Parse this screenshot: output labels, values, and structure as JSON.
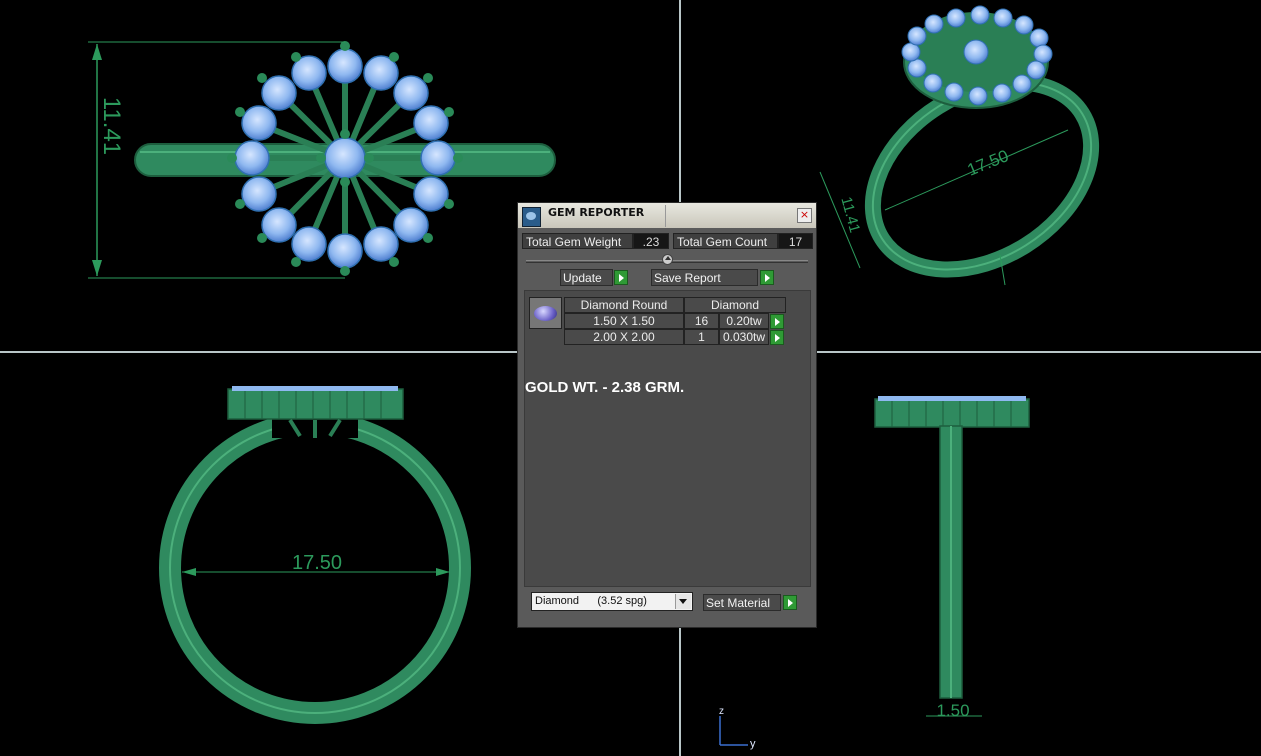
{
  "viewport": {
    "top_left_dimension": "11.41",
    "top_right_dimension_width": "17.50",
    "top_right_dimension_height": "11.41",
    "bottom_left_dimension": "17.50",
    "bottom_right_dimension": "1.50",
    "axis_z": "z",
    "axis_y": "y"
  },
  "colors": {
    "ring_green": "#2f8a5f",
    "gem_blue": "#8fb8f0",
    "dimension_line": "#2c9a5c",
    "viewport_divider": "#b9c6c8"
  },
  "dialog": {
    "title": "GEM REPORTER",
    "close_icon": "x-icon",
    "total_gem_weight_label": "Total Gem Weight",
    "total_gem_weight_value": ".23",
    "total_gem_count_label": "Total Gem Count",
    "total_gem_count_value": "17",
    "update_label": "Update",
    "save_report_label": "Save Report",
    "table": {
      "headers": [
        "Diamond Round",
        "Diamond"
      ],
      "rows": [
        {
          "size": "1.50 X 1.50",
          "count": "16",
          "weight": "0.20tw"
        },
        {
          "size": "2.00 X 2.00",
          "count": "1",
          "weight": "0.030tw"
        }
      ]
    },
    "note": "GOLD WT. - 2.38 GRM.",
    "material_select": "Diamond      (3.52 spg)",
    "set_material_label": "Set Material"
  }
}
